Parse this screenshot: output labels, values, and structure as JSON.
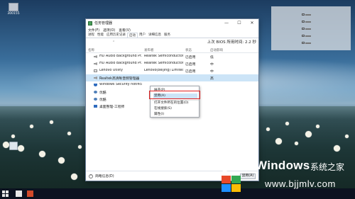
{
  "desktop": {
    "icon_label": "300155",
    "trash_label": ""
  },
  "taskmanager": {
    "title": "任务管理器",
    "window_buttons": [
      "—",
      "☐",
      "✕"
    ],
    "menu": [
      "文件(F)",
      "选项(O)",
      "查看(V)"
    ],
    "tabs": [
      "进程",
      "性能",
      "应用历史记录",
      "启动",
      "用户",
      "详细信息",
      "服务"
    ],
    "active_tab": "启动",
    "last_bios_time_label": "上次 BIOS 所用时间:",
    "last_bios_time_value": "2.2 秒",
    "columns": {
      "name": "名称",
      "publisher": "发布者",
      "status": "状态",
      "impact": "启动影响"
    },
    "rows": [
      {
        "name": "HD Audio Background Pr...",
        "publisher": "Realtek Semiconductor",
        "status": "已启用",
        "impact": "低",
        "icon": "speaker-icon"
      },
      {
        "name": "HD Audio Background Pr...",
        "publisher": "Realtek Semiconductor",
        "status": "已启用",
        "impact": "中",
        "icon": "speaker-icon"
      },
      {
        "name": "Lenovo Utility",
        "publisher": "Lenovo(beijing) Limited",
        "status": "已启用",
        "impact": "中",
        "icon": "lenovo-icon"
      },
      {
        "name": "Realtek高清晰音频管理器",
        "publisher": "",
        "status": "",
        "impact": "高",
        "icon": "speaker-icon"
      },
      {
        "name": "Windows Security notifica...",
        "publisher": "",
        "status": "",
        "impact": "",
        "icon": "shield-icon"
      },
      {
        "name": "优酷",
        "publisher": "",
        "status": "",
        "impact": "",
        "icon": "gear-icon"
      },
      {
        "name": "优酷",
        "publisher": "",
        "status": "",
        "impact": "",
        "icon": "gear-icon"
      },
      {
        "name": "桌面整理-工程师",
        "publisher": "",
        "status": "",
        "impact": "",
        "icon": "window-icon"
      }
    ],
    "footer": {
      "fewer_details": "简略信息(D)",
      "disable_button": "禁用(A)"
    }
  },
  "context_menu": {
    "items": [
      "展开(P)",
      "禁用(A)",
      "打开文件所在的位置(O)",
      "在线搜索(S)",
      "属性(I)"
    ],
    "highlighted_index": 1
  },
  "watermark": {
    "title": "Windows",
    "subtitle": "系统之家",
    "url": "www.bjjmlv.com"
  },
  "colors": {
    "selection": "#cce4f7",
    "highlight_border": "#e02020",
    "win_blue": "#1e90ff"
  }
}
